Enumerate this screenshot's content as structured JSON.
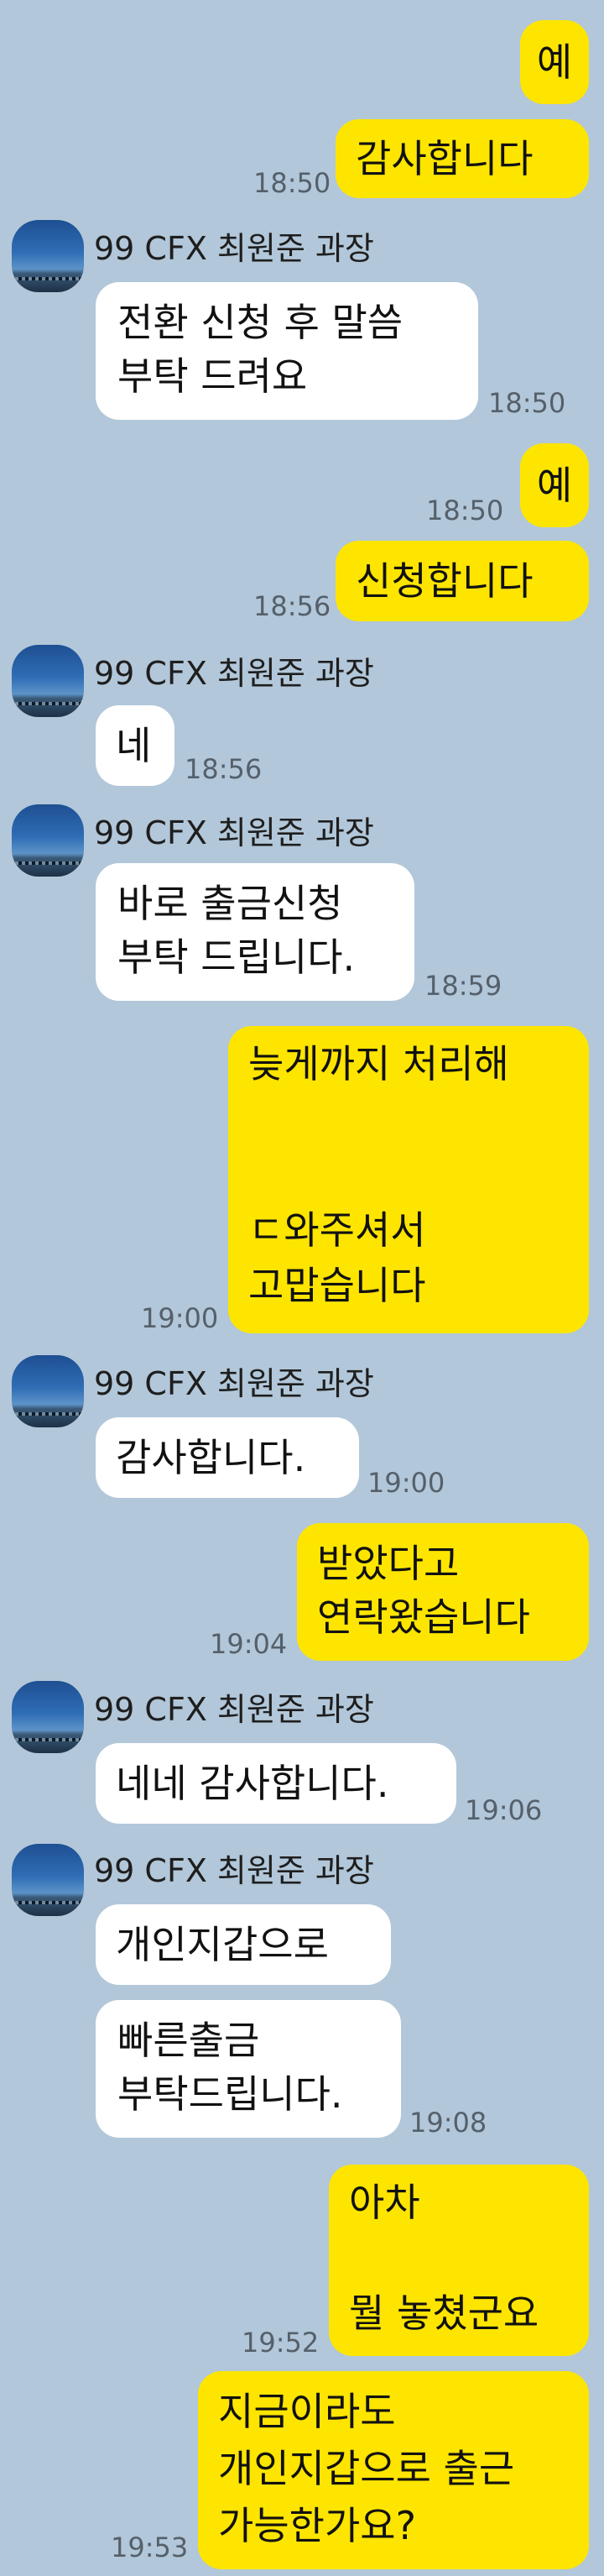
{
  "theme": {
    "background": "#b2c7d9",
    "outgoing_bubble": "#fee500",
    "incoming_bubble": "#ffffff"
  },
  "sender_name": "99 CFX 최원준 과장",
  "messages": [
    {
      "text": "예",
      "time": ""
    },
    {
      "text": "감사합니다",
      "time": "18:50"
    },
    {
      "text": "전환 신청 후 말씀\n부탁 드려요",
      "time": "18:50"
    },
    {
      "text": "예",
      "time": "18:50"
    },
    {
      "text": "신청합니다",
      "time": "18:56"
    },
    {
      "text": "네",
      "time": "18:56"
    },
    {
      "text": "바로 출금신청\n부탁 드립니다.",
      "time": "18:59"
    },
    {
      "text": "늦게까지 처리해\n\n\nㄷ와주셔서\n고맙습니다",
      "time": "19:00"
    },
    {
      "text": "감사합니다.",
      "time": "19:00"
    },
    {
      "text": "받았다고\n연락왔습니다",
      "time": "19:04"
    },
    {
      "text": "네네 감사합니다.",
      "time": "19:06"
    },
    {
      "text": "개인지갑으로",
      "time": ""
    },
    {
      "text": "빠른출금\n부탁드립니다.",
      "time": "19:08"
    },
    {
      "text": "아차\n\n뭘 놓쳤군요",
      "time": "19:52"
    },
    {
      "text": "지금이라도\n개인지갑으로 출근\n가능한가요?",
      "time": "19:53"
    }
  ]
}
